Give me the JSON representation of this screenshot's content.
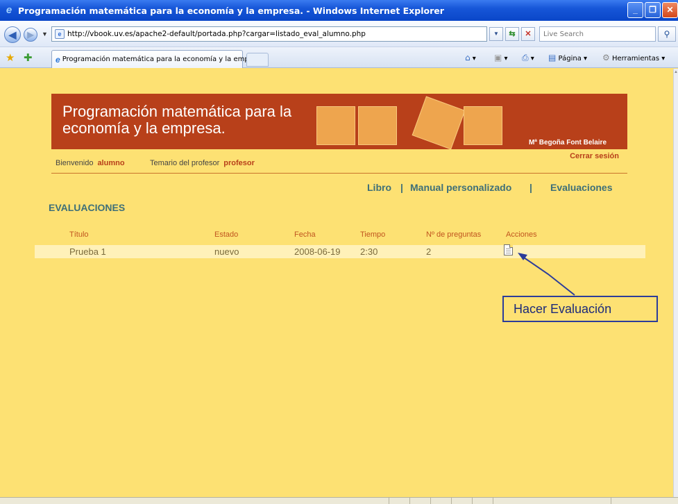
{
  "window": {
    "title": "Programación matemática para la economía y la empresa. - Windows Internet Explorer"
  },
  "addressbar": {
    "url": "http://vbook.uv.es/apache2-default/portada.php?cargar=listado_eval_alumno.php",
    "search_placeholder": "Live Search"
  },
  "tabbar": {
    "tab_label": "Programación matemática para la economía y la empr...",
    "page_menu": "Página",
    "tools_menu": "Herramientas"
  },
  "banner": {
    "title": "Programación matemática para la economía y la empresa.",
    "author": "Mª Begoña Font Belaire"
  },
  "userbar": {
    "welcome_label": "Bienvenido",
    "welcome_user": "alumno",
    "syllabus_label": "Temario del profesor",
    "syllabus_user": "profesor",
    "logout": "Cerrar sesión"
  },
  "nav": {
    "book": "Libro",
    "sep1": "|",
    "manual": "Manual personalizado",
    "sep2": "|",
    "evaluations": "Evaluaciones"
  },
  "page_heading": "EVALUACIONES",
  "table": {
    "headers": [
      "Título",
      "Estado",
      "Fecha",
      "Tiempo",
      "Nº de preguntas",
      "Acciones"
    ],
    "rows": [
      {
        "titulo": "Prueba 1",
        "estado": "nuevo",
        "fecha": "2008-06-19",
        "tiempo": "2:30",
        "preguntas": "2",
        "accion_icon": "document-icon"
      }
    ]
  },
  "annotation": {
    "text": "Hacer Evaluación",
    "color": "#2c3c9a"
  },
  "colors": {
    "page_bg": "#fde173",
    "banner_bg": "#b8401a",
    "nav_text": "#3e6f78",
    "header_text": "#c0551f"
  }
}
